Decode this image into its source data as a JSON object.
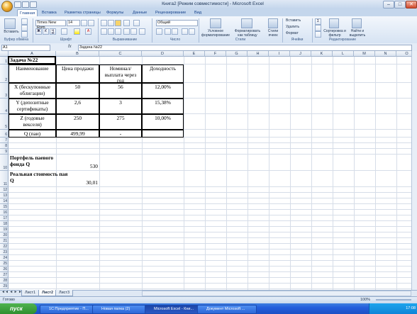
{
  "window": {
    "title": "Книга2 [Режим совместимости] - Microsoft Excel",
    "min": "–",
    "max": "□",
    "close": "✕"
  },
  "ribbon_tabs": [
    "Главная",
    "Вставка",
    "Разметка страницы",
    "Формулы",
    "Данные",
    "Рецензирование",
    "Вид"
  ],
  "ribbon": {
    "paste": "Вставить",
    "font_name": "Times New Rom",
    "font_size": "14",
    "bold": "Ж",
    "italic": "К",
    "underline": "Ч",
    "number_format": "Общий",
    "cond_format": "Условное форматирование",
    "format_table": "Форматировать как таблицу",
    "cell_styles": "Стили ячеек",
    "insert": "Вставить",
    "delete": "Удалить",
    "format": "Формат",
    "sort_filter": "Сортировка и фильтр",
    "find_select": "Найти и выделить",
    "groups": {
      "clipboard": "Буфер обмена",
      "font": "Шрифт",
      "alignment": "Выравнивание",
      "number": "Число",
      "styles": "Стили",
      "cells": "Ячейки",
      "editing": "Редактирование"
    }
  },
  "formula_bar": {
    "name_box": "A1",
    "fx": "fx",
    "content": "Задача №22"
  },
  "columns": [
    "A",
    "B",
    "C",
    "D",
    "E",
    "F",
    "G",
    "H",
    "I",
    "J",
    "K",
    "L",
    "M",
    "N",
    "O"
  ],
  "rows": [
    "1",
    "2",
    "3",
    "4",
    "5",
    "6",
    "7",
    "8",
    "9",
    "10",
    "11",
    "12",
    "13",
    "14",
    "15",
    "16",
    "17",
    "18",
    "19",
    "20",
    "21",
    "22",
    "23",
    "24",
    "25",
    "26",
    "27",
    "28",
    "29"
  ],
  "cells": {
    "a1": "Задача №22",
    "a2": "Наименование",
    "b2": "Цена продажи",
    "c2": "Номинал/ выплата через год",
    "d2": "Доходность",
    "a3": "X (бескупонные облигации)",
    "b3": "50",
    "c3": "56",
    "d3": "12,00%",
    "a4": "Y (депозитные сертификаты)",
    "b4": "2,6",
    "c4": "3",
    "d4": "15,38%",
    "a5": "Z (годовые векселя)",
    "b5": "250",
    "c5": "275",
    "d5": "10,00%",
    "a6": "Q (паи)",
    "b6": "499,99",
    "c6": "-",
    "a10": "Портфель паевого фонда Q",
    "b10": "530",
    "a11": "Реальная стоимость пая Q",
    "b11": "30,01"
  },
  "sheets": [
    "Лист1",
    "Лист2",
    "Лист3"
  ],
  "status": {
    "ready": "Готово",
    "zoom": "100%"
  },
  "taskbar": {
    "start": "пуск",
    "tasks": [
      "1С:Предприятие - П...",
      "Новая папка (2)",
      "Microsoft Excel - Кни...",
      "Документ Microsoft ..."
    ],
    "clock": "17:08"
  }
}
